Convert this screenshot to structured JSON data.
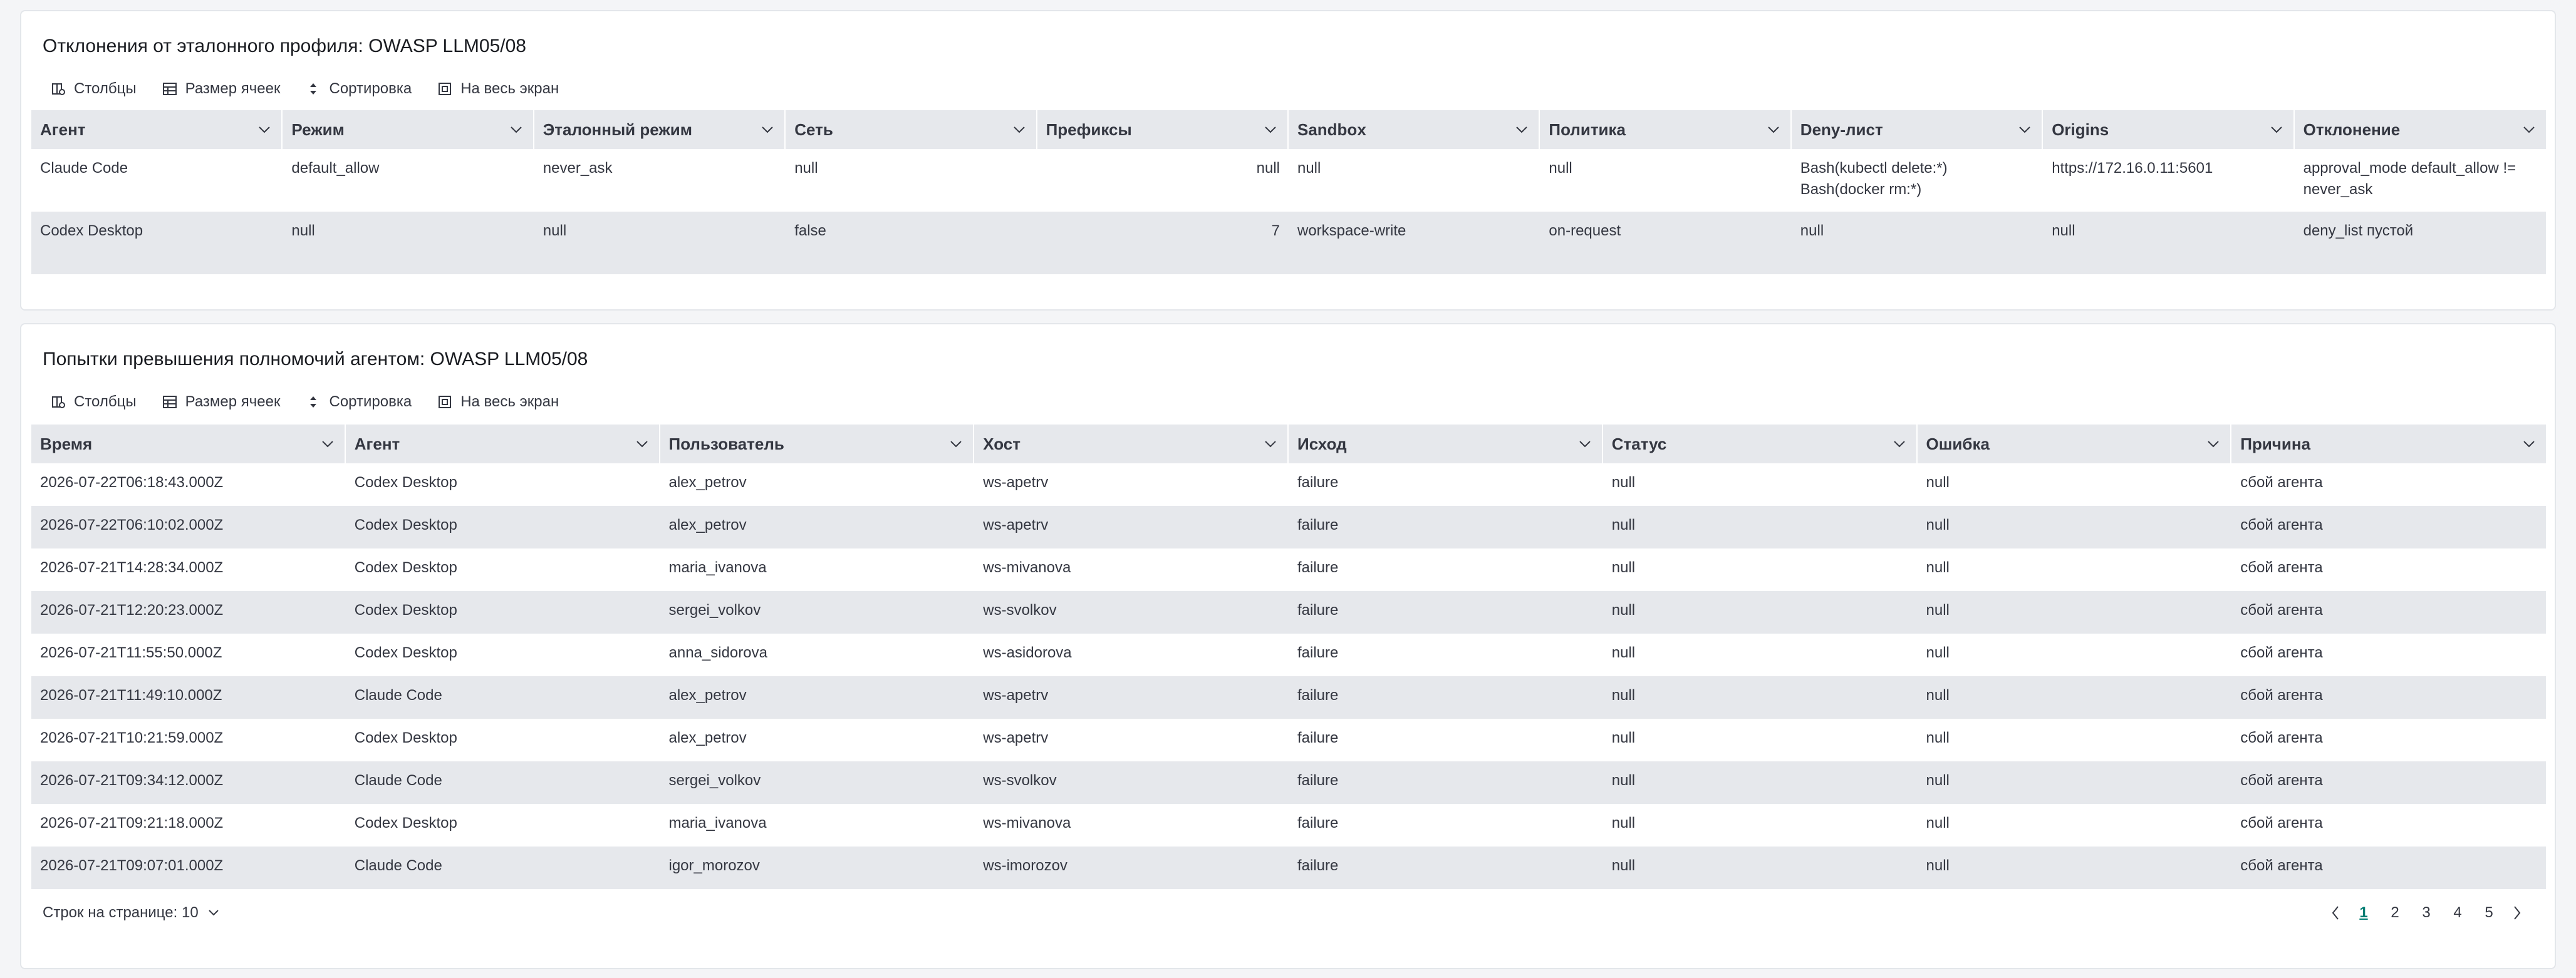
{
  "toolbar": {
    "columns": "Столбцы",
    "cell_size": "Размер ячеек",
    "sort": "Сортировка",
    "fullscreen": "На весь экран"
  },
  "deviations": {
    "title": "Отклонения от эталонного профиля: OWASP LLM05/08",
    "headers": [
      "Агент",
      "Режим",
      "Эталонный режим",
      "Сеть",
      "Префиксы",
      "Sandbox",
      "Политика",
      "Deny-лист",
      "Origins",
      "Отклонение"
    ],
    "rows": [
      [
        "Claude Code",
        "default_allow",
        "never_ask",
        "null",
        "null",
        "null",
        "null",
        "Bash(kubectl delete:*)\nBash(docker rm:*)",
        "https://172.16.0.11:5601",
        "approval_mode default_allow != never_ask"
      ],
      [
        "Codex Desktop",
        "null",
        "null",
        "false",
        "7",
        "workspace-write",
        "on-request",
        "null",
        "null",
        "deny_list пустой"
      ]
    ]
  },
  "attempts": {
    "title": "Попытки превышения полномочий агентом: OWASP LLM05/08",
    "headers": [
      "Время",
      "Агент",
      "Пользователь",
      "Хост",
      "Исход",
      "Статус",
      "Ошибка",
      "Причина"
    ],
    "rows": [
      [
        "2026-07-22T06:18:43.000Z",
        "Codex Desktop",
        "alex_petrov",
        "ws-apetrv",
        "failure",
        "null",
        "null",
        "сбой агента"
      ],
      [
        "2026-07-22T06:10:02.000Z",
        "Codex Desktop",
        "alex_petrov",
        "ws-apetrv",
        "failure",
        "null",
        "null",
        "сбой агента"
      ],
      [
        "2026-07-21T14:28:34.000Z",
        "Codex Desktop",
        "maria_ivanova",
        "ws-mivanova",
        "failure",
        "null",
        "null",
        "сбой агента"
      ],
      [
        "2026-07-21T12:20:23.000Z",
        "Codex Desktop",
        "sergei_volkov",
        "ws-svolkov",
        "failure",
        "null",
        "null",
        "сбой агента"
      ],
      [
        "2026-07-21T11:55:50.000Z",
        "Codex Desktop",
        "anna_sidorova",
        "ws-asidorova",
        "failure",
        "null",
        "null",
        "сбой агента"
      ],
      [
        "2026-07-21T11:49:10.000Z",
        "Claude Code",
        "alex_petrov",
        "ws-apetrv",
        "failure",
        "null",
        "null",
        "сбой агента"
      ],
      [
        "2026-07-21T10:21:59.000Z",
        "Codex Desktop",
        "alex_petrov",
        "ws-apetrv",
        "failure",
        "null",
        "null",
        "сбой агента"
      ],
      [
        "2026-07-21T09:34:12.000Z",
        "Claude Code",
        "sergei_volkov",
        "ws-svolkov",
        "failure",
        "null",
        "null",
        "сбой агента"
      ],
      [
        "2026-07-21T09:21:18.000Z",
        "Codex Desktop",
        "maria_ivanova",
        "ws-mivanova",
        "failure",
        "null",
        "null",
        "сбой агента"
      ],
      [
        "2026-07-21T09:07:01.000Z",
        "Claude Code",
        "igor_morozov",
        "ws-imorozov",
        "failure",
        "null",
        "null",
        "сбой агента"
      ]
    ],
    "rows_per_page": "Строк на странице: 10",
    "pages": [
      "1",
      "2",
      "3",
      "4",
      "5"
    ],
    "active_page": "1"
  },
  "colors": {
    "header_bg": "#e6e8ec",
    "active_page": "#017d73",
    "text": "#343741"
  }
}
